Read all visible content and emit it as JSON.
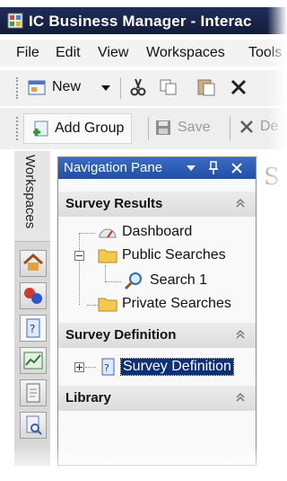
{
  "window": {
    "title": "IC Business Manager - Interac"
  },
  "menu": [
    "File",
    "Edit",
    "View",
    "Workspaces",
    "Tools"
  ],
  "toolbar": {
    "new_label": "New",
    "add_group_label": "Add Group",
    "save_label": "Save",
    "delete_label": "De"
  },
  "workspaces": {
    "label": "Workspaces"
  },
  "nav": {
    "title": "Navigation Pane",
    "sections": {
      "survey_results": "Survey Results",
      "survey_definition": "Survey Definition",
      "library": "Library"
    },
    "items": {
      "dashboard": "Dashboard",
      "public_searches": "Public Searches",
      "search1": "Search 1",
      "private_searches": "Private Searches",
      "survey_definition": "Survey Definition"
    }
  },
  "content": {
    "heading_partial": "S"
  },
  "icons": [
    "app-icon",
    "new-icon",
    "dropdown-icon",
    "cut-icon",
    "copy-icon",
    "paste-icon",
    "delete-icon",
    "add-group-icon",
    "save-icon",
    "close-x-icon",
    "home-icon",
    "group-icon",
    "survey-icon",
    "chart-icon",
    "document-icon",
    "search-doc-icon",
    "pin-icon",
    "close-icon",
    "chevron-up-icon",
    "dashboard-icon",
    "folder-icon",
    "magnifier-icon",
    "survey-definition-icon"
  ],
  "colors": {
    "titlebar": "#1f2e59",
    "nav_header": "#2b5cb5",
    "selection": "#0b2f78"
  }
}
